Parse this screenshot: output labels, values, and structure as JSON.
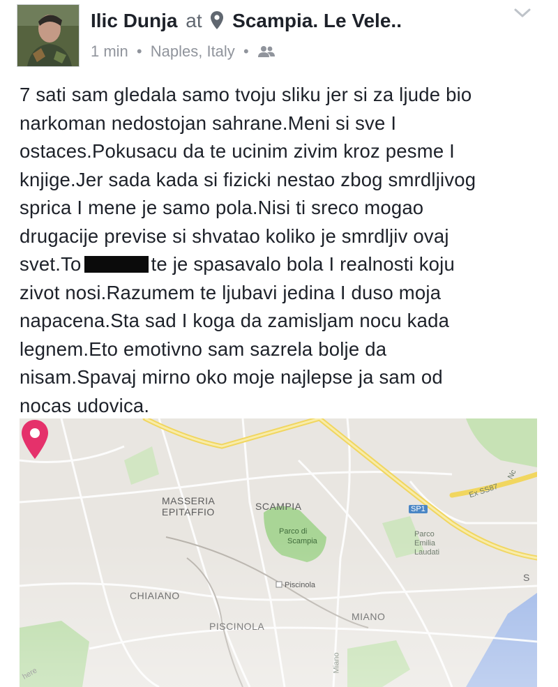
{
  "post": {
    "author": "Ilic Dunja",
    "at_word": "at",
    "place": "Scampia. Le Vele..",
    "time": "1 min",
    "separator": "•",
    "location": "Naples, Italy",
    "audience_icon": "friends-icon",
    "options_icon": "chevron-down-icon",
    "text_lines": [
      "7 sati sam gledala samo tvoju sliku jer si za ljude bio",
      "narkoman nedostojan sahrane.Meni si sve I",
      "ostaces.Pokusacu da te ucinim zivim kroz pesme I",
      "knjige.Jer sada kada si fizicki nestao zbog smrdljivog",
      "sprica I mene je samo pola.Nisi ti sreco mogao",
      "drugacije previse si shvatao koliko je smrdljiv ovaj",
      "zivot nosi.Razumem te ljubavi jedina I duso moja",
      "napacena.Sta sad I koga da zamisljam nocu kada",
      "legnem.Eto emotivno sam sazrela bolje da",
      "nisam.Spavaj mirno oko moje najlepse ja sam od",
      "nocas udovica."
    ],
    "redacted_line": {
      "before": "svet.To",
      "after": "te je spasavalo bola I realnosti koju"
    }
  },
  "map": {
    "labels": {
      "masseria": "MASSERIA",
      "epitaffio": "EPITAFFIO",
      "scampia": "SCAMPIA",
      "chiaiano": "CHIAIANO",
      "piscinola": "PISCINOLA",
      "miano": "MIANO",
      "ex_ss87": "Ex SS87",
      "nc": "Nc",
      "sp1": "SP1",
      "parco_scampia_1": "Parco di",
      "parco_scampia_2": "Scampia",
      "parco_emilia_1": "Parco",
      "parco_emilia_2": "Emilia",
      "parco_emilia_3": "Laudati",
      "station": "Piscinola",
      "miano_road": "Miano",
      "edge_s": "S",
      "watermark": "here"
    },
    "pin_color": "#e5316b"
  },
  "colors": {
    "text": "#1d2129",
    "meta": "#90949c",
    "map_bg": "#e9e6e1",
    "park": "#a9d596",
    "road_yellow": "#f4e27a",
    "water": "#9fb8e8"
  }
}
